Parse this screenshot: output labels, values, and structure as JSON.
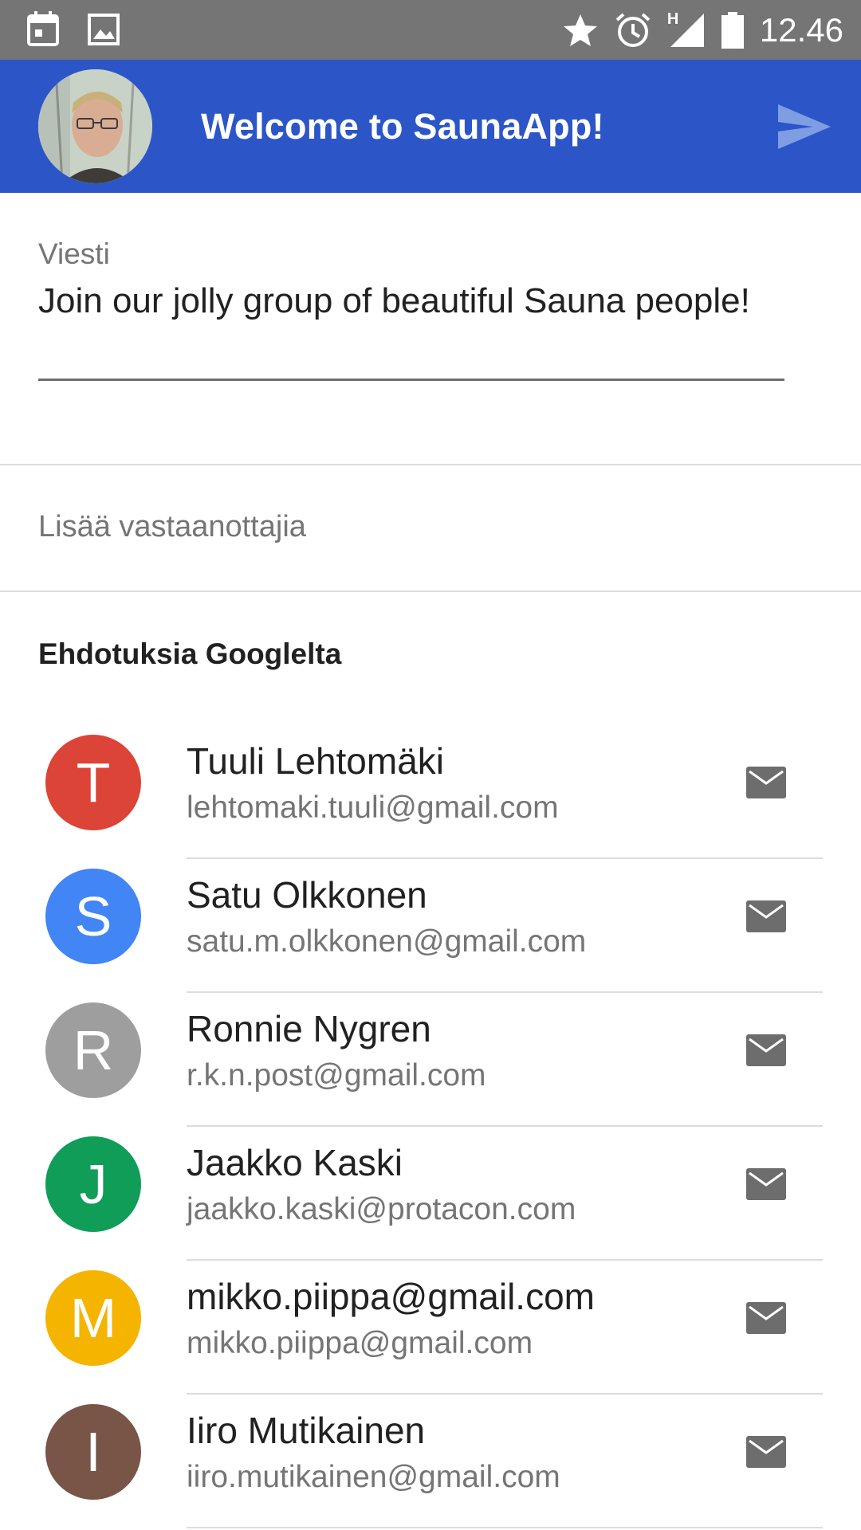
{
  "status_bar": {
    "time": "12.46",
    "network_label": "H",
    "left_icons": [
      "calendar-icon",
      "image-icon"
    ],
    "right_icons": [
      "star-icon",
      "alarm-icon",
      "signal-icon",
      "battery-icon"
    ]
  },
  "app_bar": {
    "title": "Welcome to SaunaApp!",
    "color": "#2c56c7",
    "send_icon": "send-icon"
  },
  "message": {
    "label": "Viesti",
    "value": "Join our jolly group of beautiful Sauna people!"
  },
  "recipients": {
    "placeholder": "Lisää vastaanottajia"
  },
  "suggestions": {
    "title": "Ehdotuksia Googlelta",
    "contacts": [
      {
        "initial": "T",
        "name": "Tuuli Lehtomäki",
        "email": "lehtomaki.tuuli@gmail.com",
        "color": "#db4437"
      },
      {
        "initial": "S",
        "name": "Satu Olkkonen",
        "email": "satu.m.olkkonen@gmail.com",
        "color": "#4285f4"
      },
      {
        "initial": "R",
        "name": "Ronnie Nygren",
        "email": "r.k.n.post@gmail.com",
        "color": "#9e9e9e"
      },
      {
        "initial": "J",
        "name": "Jaakko Kaski",
        "email": "jaakko.kaski@protacon.com",
        "color": "#0f9d58"
      },
      {
        "initial": "M",
        "name": "mikko.piippa@gmail.com",
        "email": "mikko.piippa@gmail.com",
        "color": "#f4b400"
      },
      {
        "initial": "I",
        "name": "Iiro Mutikainen",
        "email": "iiro.mutikainen@gmail.com",
        "color": "#795548"
      }
    ]
  }
}
